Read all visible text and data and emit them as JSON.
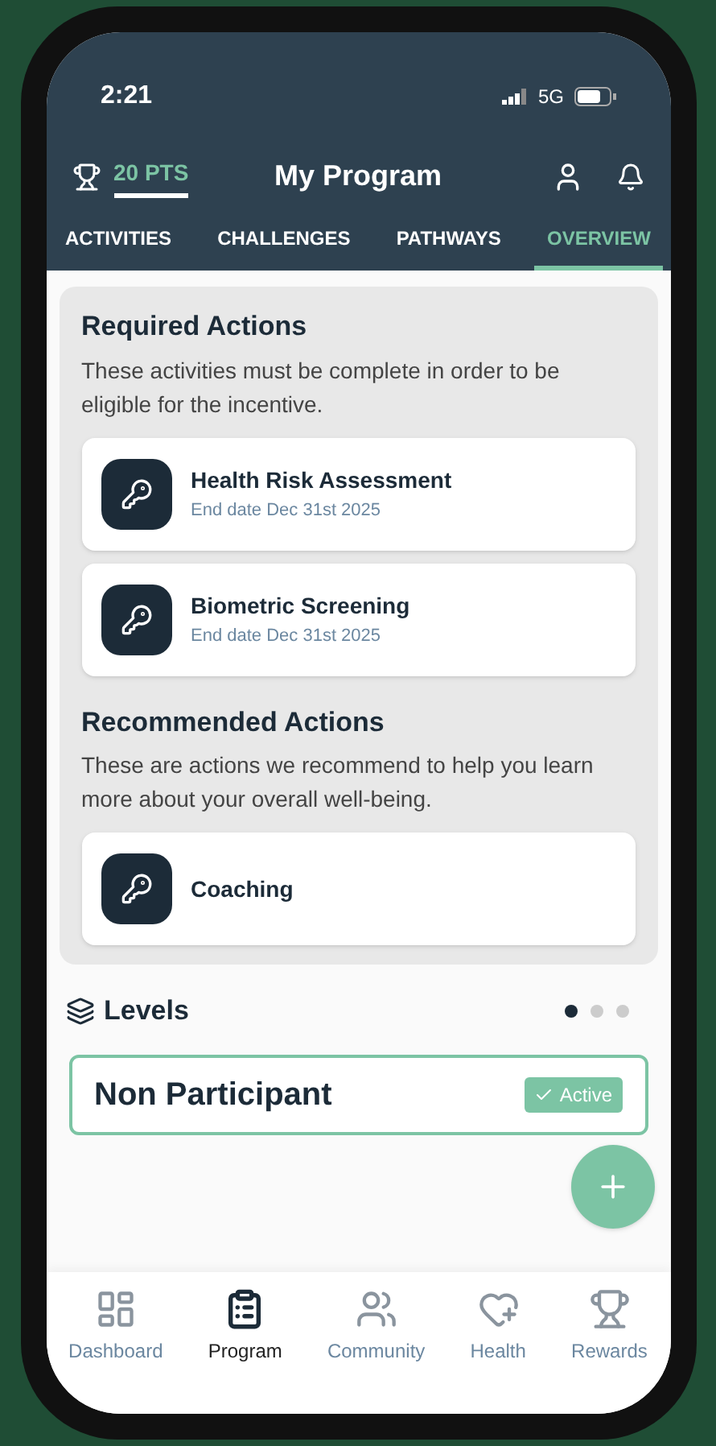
{
  "status_bar": {
    "time": "2:21",
    "network": "5G"
  },
  "header": {
    "points": "20 PTS",
    "title": "My Program"
  },
  "tabs": [
    {
      "label": "ACTIVITIES",
      "selected": false
    },
    {
      "label": "CHALLENGES",
      "selected": false
    },
    {
      "label": "PATHWAYS",
      "selected": false
    },
    {
      "label": "OVERVIEW",
      "selected": true
    }
  ],
  "sections": [
    {
      "title": "Required Actions",
      "description": "These activities must be complete in order to be eligible for the incentive.",
      "items": [
        {
          "name": "Health Risk Assessment",
          "date": "End date Dec 31st 2025"
        },
        {
          "name": "Biometric Screening",
          "date": "End date Dec 31st 2025"
        }
      ]
    },
    {
      "title": "Recommended Actions",
      "description": "These are actions we recommend to help you learn more about your overall well-being.",
      "items": [
        {
          "name": "Coaching"
        }
      ]
    }
  ],
  "levels": {
    "title": "Levels",
    "pages": [
      {
        "selected": true
      },
      {
        "selected": false
      },
      {
        "selected": false
      }
    ],
    "card": {
      "name": "Non Participant",
      "status": "Active"
    }
  },
  "bottom_nav": [
    {
      "label": "Dashboard",
      "kind": "dashboard",
      "selected": false
    },
    {
      "label": "Program",
      "kind": "program",
      "selected": true
    },
    {
      "label": "Community",
      "kind": "community",
      "selected": false
    },
    {
      "label": "Health",
      "kind": "health",
      "selected": false
    },
    {
      "label": "Rewards",
      "kind": "rewards",
      "selected": false
    }
  ]
}
